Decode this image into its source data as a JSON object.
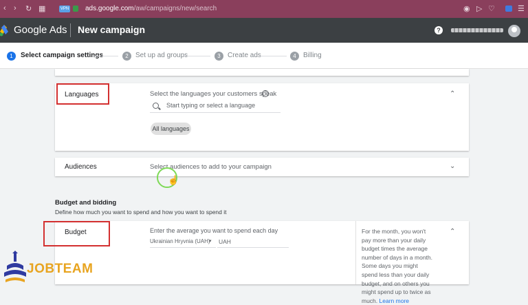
{
  "browser": {
    "vpn_label": "VPN",
    "url_host": "ads.google.com",
    "url_path": "/aw/campaigns/new/search"
  },
  "header": {
    "brand": "Google Ads",
    "title": "New campaign",
    "help_glyph": "?"
  },
  "stepper": {
    "steps": [
      {
        "number": "1",
        "label": "Select campaign settings",
        "active": true
      },
      {
        "number": "2",
        "label": "Set up ad groups",
        "active": false
      },
      {
        "number": "3",
        "label": "Create ads",
        "active": false
      },
      {
        "number": "4",
        "label": "Billing",
        "active": false
      }
    ]
  },
  "languages": {
    "title": "Languages",
    "prompt": "Select the languages your customers speak",
    "search_placeholder": "Start typing or select a language",
    "chip": "All languages"
  },
  "audiences": {
    "title": "Audiences",
    "prompt": "Select audiences to add to your campaign"
  },
  "budget_section": {
    "title": "Budget and bidding",
    "subtitle": "Define how much you want to spend and how you want to spend it"
  },
  "budget": {
    "title": "Budget",
    "prompt": "Enter the average you want to spend each day",
    "currency": "Ukrainian Hryvnia (UAH)",
    "currency_code": "UAH",
    "side_text": "For the month, you won't pay more than your daily budget times the average number of days in a month. Some days you might spend less than your daily budget, and on others you might spend up to twice as much.",
    "learn_more": "Learn more"
  },
  "watermark": {
    "text": "JOBTEAM"
  },
  "colors": {
    "browser_bar": "#8a3f5c",
    "header": "#3c4043",
    "active_step": "#1a73e8",
    "inactive_step": "#9aa0a6",
    "annotation_red": "#d32f2f",
    "cursor_ring": "#7ed957",
    "watermark_orange": "#e8a420"
  }
}
